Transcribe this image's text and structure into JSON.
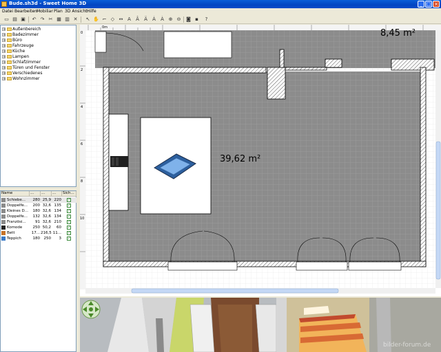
{
  "window": {
    "title": "Bude.sh3d - Sweet Home 3D",
    "controls": {
      "minimize": "_",
      "maximize": "□",
      "close": "×"
    }
  },
  "menu": [
    "Datei",
    "Bearbeiten",
    "Mobiliar",
    "Plan",
    "3D Ansicht",
    "Hilfe"
  ],
  "toolbar_icons": [
    "new-icon",
    "open-icon",
    "save-icon",
    "undo-icon",
    "redo-icon",
    "cut-icon",
    "copy-icon",
    "paste-icon",
    "delete-icon",
    "add-furniture-icon",
    "select-icon",
    "pan-icon",
    "create-walls-icon",
    "create-rooms-icon",
    "create-dimensions-icon",
    "add-text-icon",
    "text-style-icon",
    "zoom-in-icon",
    "zoom-out-icon",
    "photo-icon",
    "video-icon",
    "help-icon"
  ],
  "catalog": {
    "categories": [
      "Außenbereich",
      "Badezimmer",
      "Büro",
      "Fahrzeuge",
      "Küche",
      "Lampen",
      "Schlafzimmer",
      "Türen und Fenster",
      "Verschiedenes",
      "Wohnzimmer"
    ]
  },
  "furniture_table": {
    "headers": [
      "Name",
      "...",
      "...",
      "...",
      "Sich..."
    ],
    "rows": [
      {
        "name": "Schiebe...",
        "w": "280",
        "d": "25,9",
        "h": "220",
        "visible": true
      },
      {
        "name": "Doppelfe...",
        "w": "200",
        "d": "32,6",
        "h": "135",
        "visible": true
      },
      {
        "name": "Kleines D...",
        "w": "180",
        "d": "32,6",
        "h": "134",
        "visible": true
      },
      {
        "name": "Doppelfe...",
        "w": "132",
        "d": "32,6",
        "h": "134",
        "visible": true
      },
      {
        "name": "Französi...",
        "w": "91",
        "d": "32,6",
        "h": "210",
        "visible": true
      },
      {
        "name": "Komode",
        "w": "250",
        "d": "50,2",
        "h": "60",
        "visible": true
      },
      {
        "name": "Bett",
        "w": "17...",
        "d": "216,5",
        "h": "11...",
        "visible": true
      },
      {
        "name": "Teppich",
        "w": "180",
        "d": "250",
        "h": "3",
        "visible": true
      }
    ]
  },
  "plan": {
    "ruler_top_label": "0m",
    "ruler_left_labels": [
      "0",
      "2",
      "4",
      "6",
      "8",
      "10"
    ],
    "rooms": [
      {
        "area": "39,62 m²"
      },
      {
        "area": "8,45 m²"
      }
    ],
    "colors": {
      "floor": "#8c8c8c",
      "grid": "#a0a0a0",
      "wall_fill": "#ffffff",
      "hatch": "#555555"
    }
  },
  "view3d": {
    "nav_icon": "navigation-arrows-icon",
    "watermark": "bilder-forum.de"
  }
}
